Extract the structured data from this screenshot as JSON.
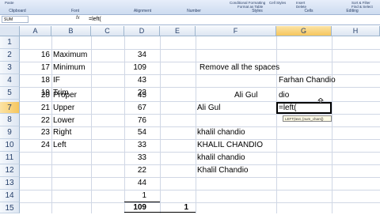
{
  "ribbon": {
    "groups": [
      "Clipboard",
      "Font",
      "Alignment",
      "Number",
      "Styles",
      "Cells",
      "Editing"
    ],
    "buttons": [
      "Paste",
      "Conditional Formatting",
      "Format as Table",
      "Cell Styles",
      "Insert",
      "Delete",
      "Format",
      "Sort & Filter",
      "Find & Select"
    ]
  },
  "formula_bar": {
    "name_box": "SUM",
    "fx": "fx",
    "formula": "=left("
  },
  "columns": [
    "A",
    "B",
    "C",
    "D",
    "E",
    "F",
    "G",
    "H"
  ],
  "rows": [
    "1",
    "2",
    "3",
    "4",
    "5",
    "6",
    "7",
    "8",
    "9",
    "10",
    "11",
    "12",
    "13",
    "14",
    "15"
  ],
  "cells": {
    "A2": "16",
    "B2": "Maximum",
    "D2": "34",
    "A3": "17",
    "B3": "Minimum",
    "D3": "109",
    "A4": "18",
    "B4": "IF",
    "D4": "43",
    "A5": "19",
    "B5": "Trim",
    "D5": "23",
    "A6": "20",
    "B6": "Proper",
    "D6": "45",
    "A7": "21",
    "B7": "Upper",
    "D7": "67",
    "A8": "22",
    "B8": "Lower",
    "D8": "76",
    "A9": "23",
    "B9": "Right",
    "D9": "54",
    "A10": "24",
    "B10": "Left",
    "D10": "33",
    "D11": "33",
    "D12": "22",
    "D13": "44",
    "D14": "1",
    "D15": "109",
    "E15": "1",
    "F4": "Remove all the spaces",
    "G5": "Farhan Chandio",
    "F6": "Ali Gul",
    "G6": "dio",
    "F7": "Ali Gul",
    "G7": "=left(",
    "F9": "khalil chandio",
    "F10": "KHALIL CHANDIO",
    "F11": "khalil chandio",
    "F12": "Khalil Chandio"
  },
  "tooltip": "LEFT(text, [num_chars])",
  "active_cell": "G7"
}
